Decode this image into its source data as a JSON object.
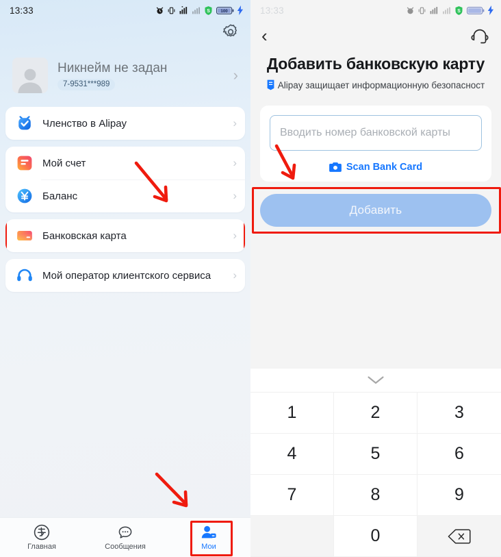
{
  "left_screen": {
    "status_bar": {
      "time": "13:33",
      "icons": [
        "alarm-clock-icon",
        "vibrate-icon",
        "signal-bars-icon",
        "signal-bars-secondary-icon",
        "security-shield-icon",
        "battery-icon",
        "charging-bolt-icon"
      ],
      "battery_level": "100"
    },
    "settings_button": "gear-icon",
    "profile": {
      "avatar": "person-placeholder-avatar",
      "nickname": "Никнейм не задан",
      "phone": "7-9531***989",
      "chevron": "›"
    },
    "menu_groups": [
      {
        "items": [
          {
            "icon": "alipay-membership-icon",
            "label": "Членство в Alipay",
            "chevron": "›",
            "highlighted": false
          }
        ]
      },
      {
        "items": [
          {
            "icon": "my-account-icon",
            "label": "Мой счет",
            "chevron": "›",
            "highlighted": false
          },
          {
            "icon": "balance-yuan-icon",
            "label": "Баланс",
            "chevron": "›",
            "highlighted": false
          }
        ]
      },
      {
        "items": [
          {
            "icon": "bank-card-icon",
            "label": "Банковская карта",
            "chevron": "›",
            "highlighted": true
          }
        ]
      },
      {
        "items": [
          {
            "icon": "headset-support-icon",
            "label": "Мой оператор клиентского сервиса",
            "chevron": "›",
            "highlighted": false
          }
        ]
      }
    ],
    "tabbar": [
      {
        "icon": "alipay-logo-icon",
        "label": "Главная",
        "active": false
      },
      {
        "icon": "messages-bubble-icon",
        "label": "Сообщения",
        "active": false
      },
      {
        "icon": "profile-person-icon",
        "label": "Мои",
        "active": true
      }
    ]
  },
  "right_screen": {
    "status_bar": {
      "time": "13:33",
      "icons": [
        "alarm-clock-icon",
        "vibrate-icon",
        "signal-bars-icon",
        "signal-bars-secondary-icon",
        "security-shield-icon",
        "battery-icon",
        "charging-bolt-icon"
      ],
      "battery_level": "100"
    },
    "nav": {
      "back": "‹",
      "help_icon": "headset-icon"
    },
    "title": "Добавить банковскую карту",
    "secure_notice": {
      "icon": "alipay-shield-icon",
      "text": "Alipay защищает информационную безопасност"
    },
    "form": {
      "card_number_value": "",
      "card_number_placeholder": "Вводить номер банковской карты",
      "scan_icon": "camera-icon",
      "scan_label": "Scan Bank Card",
      "submit_label": "Добавить"
    },
    "keypad": {
      "collapse_icon": "chevron-down-icon",
      "keys": [
        "1",
        "2",
        "3",
        "4",
        "5",
        "6",
        "7",
        "8",
        "9",
        "",
        "0",
        "backspace-icon"
      ],
      "backspace_icon": "backspace-icon"
    }
  },
  "annotations": {
    "highlight_color": "#ef1b0e",
    "boxes": [
      "bank-card-row",
      "profile-tab",
      "add-button"
    ],
    "arrows": [
      "arrow-to-bank-card-row",
      "arrow-to-profile-tab",
      "arrow-to-card-input"
    ]
  },
  "theme": {
    "accent_blue": "#1677ff",
    "button_blue": "#9dc1f0",
    "bg_gray": "#f4f4f4",
    "card_white": "#ffffff",
    "text_dark": "#20232a",
    "text_muted": "#a9aeb4"
  }
}
